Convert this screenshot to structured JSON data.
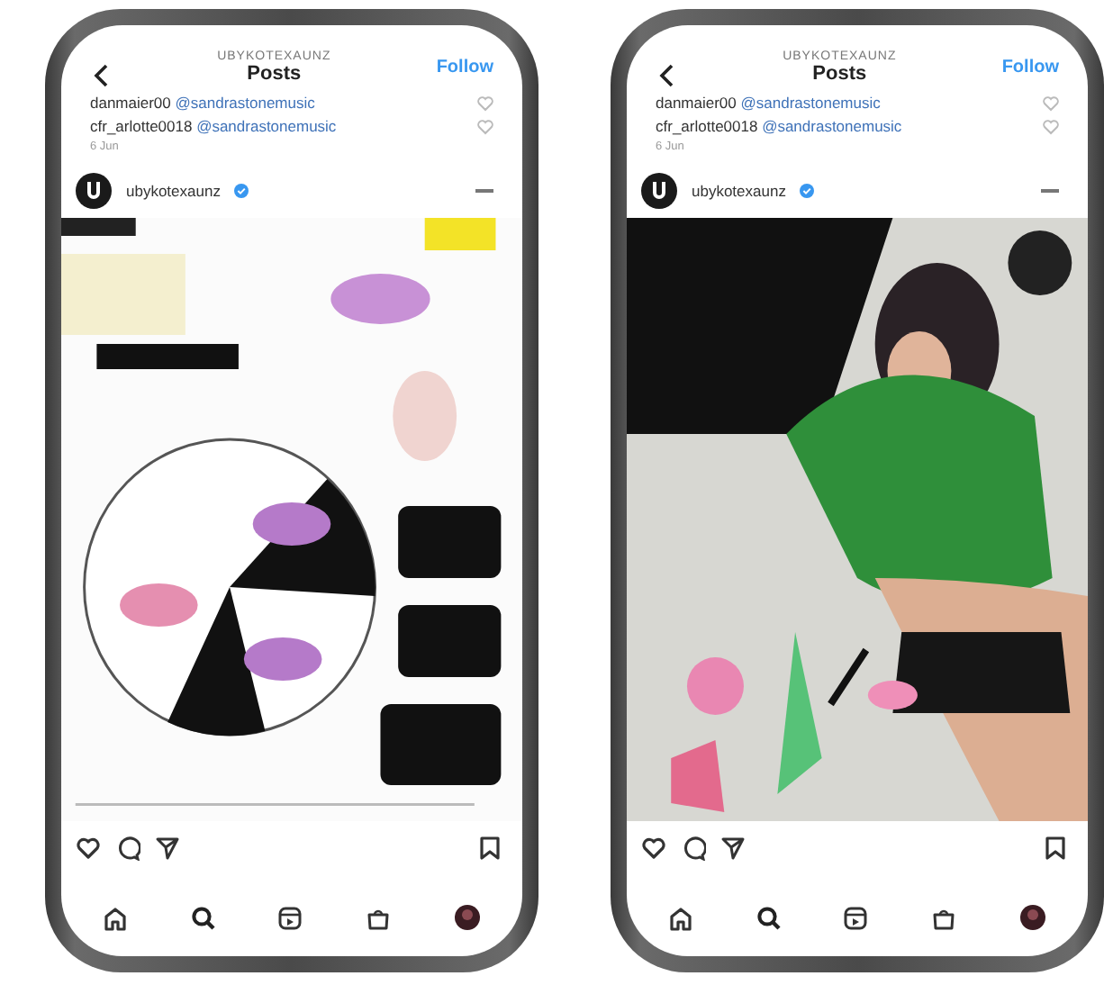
{
  "phones": [
    {
      "header": {
        "account": "UBYKOTEXAUNZ",
        "title": "Posts",
        "follow": "Follow"
      },
      "comments": [
        {
          "user": "danmaier00",
          "mention": "@sandrastonemusic"
        },
        {
          "user": "cfr_arlotte0018",
          "mention": "@sandrastonemusic"
        }
      ],
      "comment_time": "6 Jun",
      "post": {
        "username": "ubykotexaunz"
      }
    },
    {
      "header": {
        "account": "UBYKOTEXAUNZ",
        "title": "Posts",
        "follow": "Follow"
      },
      "comments": [
        {
          "user": "danmaier00",
          "mention": "@sandrastonemusic"
        },
        {
          "user": "cfr_arlotte0018",
          "mention": "@sandrastonemusic"
        }
      ],
      "comment_time": "6 Jun",
      "post": {
        "username": "ubykotexaunz"
      }
    }
  ]
}
